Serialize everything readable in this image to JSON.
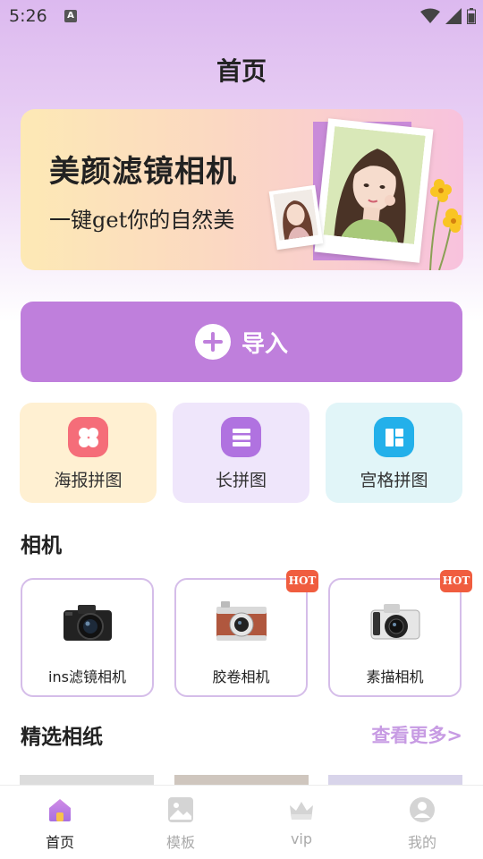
{
  "status_bar": {
    "time": "5:26",
    "notification_icon": "A"
  },
  "header": {
    "title": "首页"
  },
  "banner": {
    "title": "美颜滤镜相机",
    "subtitle": "一键get你的自然美"
  },
  "import_button": {
    "label": "导入"
  },
  "tools": [
    {
      "label": "海报拼图",
      "icon": "flower-icon",
      "bg": "#fff0d2",
      "icon_color": "#f56d79"
    },
    {
      "label": "长拼图",
      "icon": "stack-icon",
      "bg": "#efe6fb",
      "icon_color": "#b072e0"
    },
    {
      "label": "宫格拼图",
      "icon": "grid-icon",
      "bg": "#e1f5f8",
      "icon_color": "#23b0ea"
    }
  ],
  "cameras_section": {
    "title": "相机"
  },
  "cameras": [
    {
      "label": "ins滤镜相机",
      "hot": false
    },
    {
      "label": "胶卷相机",
      "hot": true
    },
    {
      "label": "素描相机",
      "hot": true
    }
  ],
  "hot_badge": "HOT",
  "papers_section": {
    "title": "精选相纸",
    "see_more": "查看更多>"
  },
  "bottom_nav": [
    {
      "label": "首页",
      "icon": "home-icon",
      "active": true
    },
    {
      "label": "模板",
      "icon": "image-icon",
      "active": false
    },
    {
      "label": "vip",
      "icon": "crown-icon",
      "active": false
    },
    {
      "label": "我的",
      "icon": "profile-icon",
      "active": false
    }
  ],
  "colors": {
    "accent": "#bf7fdc",
    "hot": "#f05d3f",
    "link": "#c79be3"
  }
}
